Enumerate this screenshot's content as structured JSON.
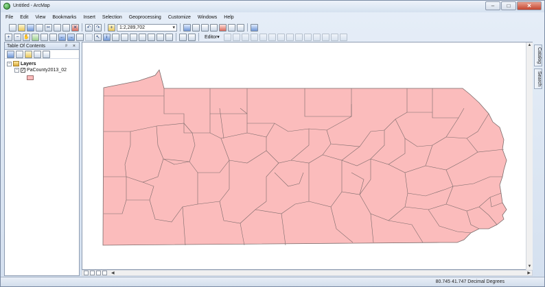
{
  "window": {
    "title": "Untitled - ArcMap",
    "controls": {
      "minimize": "–",
      "maximize": "□",
      "close": "✕"
    }
  },
  "menu": [
    "File",
    "Edit",
    "View",
    "Bookmarks",
    "Insert",
    "Selection",
    "Geoprocessing",
    "Customize",
    "Windows",
    "Help"
  ],
  "toolbar": {
    "scale_value": "1:2,289,702",
    "editor_label": "Editor▾"
  },
  "toc": {
    "title": "Table Of Contents",
    "header_buttons": "ᵖ ×",
    "layers_label": "Layers",
    "layer_name": "PaCounty2013_02",
    "layer_fill_color": "#fbbcbc",
    "layer_outline_color": "#7a6a6a"
  },
  "side_tabs": [
    "Catalog",
    "Search"
  ],
  "status": {
    "coordinates": "80.745  41.747 Decimal Degrees"
  }
}
